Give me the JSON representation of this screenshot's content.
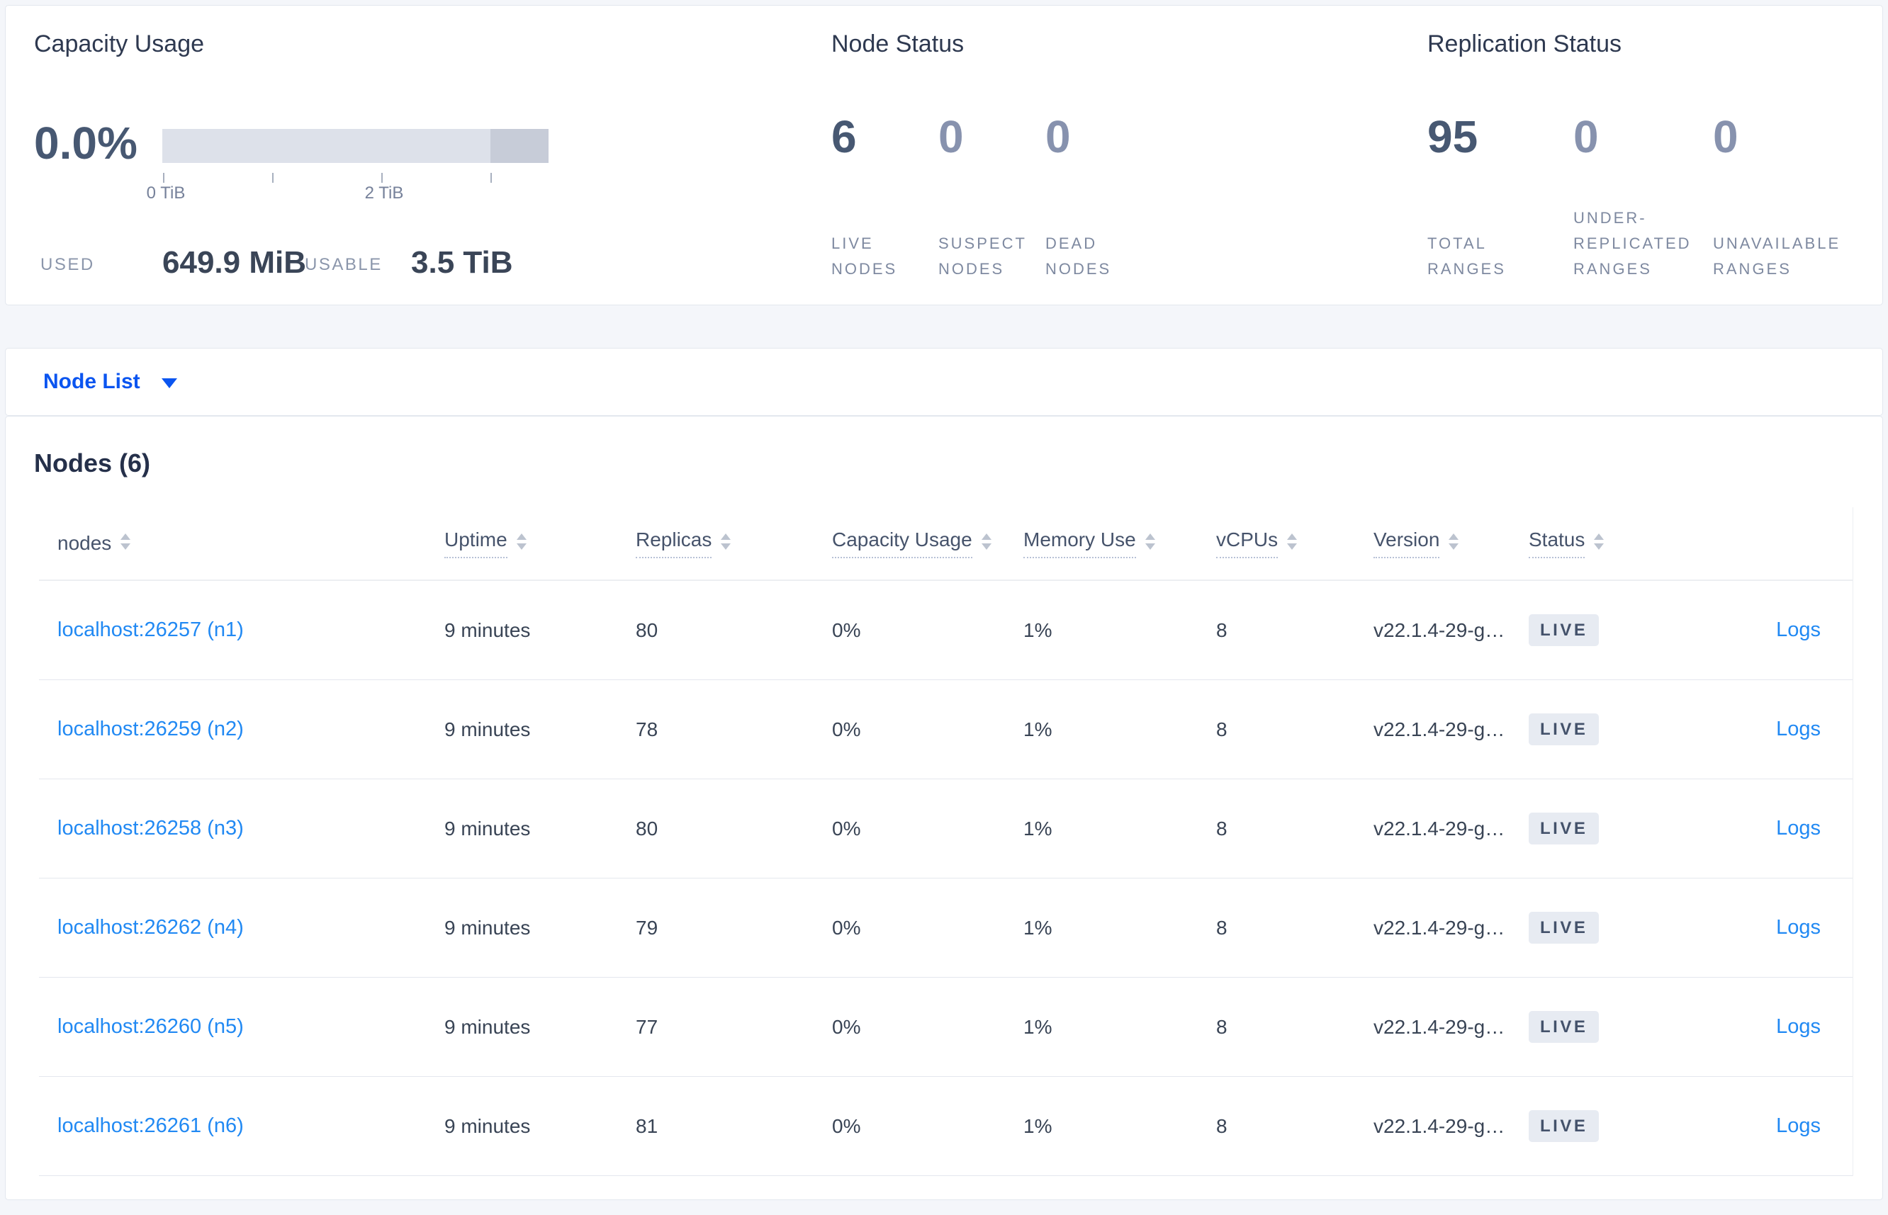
{
  "summary": {
    "capacity": {
      "title": "Capacity Usage",
      "percent": "0.0%",
      "axis_ticks": [
        "0 TiB",
        "2 TiB"
      ],
      "used_label": "USED",
      "used_value": "649.9 MiB",
      "usable_label": "USABLE",
      "usable_value": "3.5 TiB"
    },
    "node_status": {
      "title": "Node Status",
      "metrics": [
        {
          "value": "6",
          "label": "LIVE\nNODES",
          "emphasized": true
        },
        {
          "value": "0",
          "label": "SUSPECT\nNODES",
          "emphasized": false
        },
        {
          "value": "0",
          "label": "DEAD\nNODES",
          "emphasized": false
        }
      ]
    },
    "replication_status": {
      "title": "Replication Status",
      "metrics": [
        {
          "value": "95",
          "label": "TOTAL\nRANGES",
          "emphasized": true
        },
        {
          "value": "0",
          "label": "UNDER-\nREPLICATED\nRANGES",
          "emphasized": false
        },
        {
          "value": "0",
          "label": "UNAVAILABLE\nRANGES",
          "emphasized": false
        }
      ]
    }
  },
  "view_selector": {
    "label": "Node List"
  },
  "nodes_table": {
    "heading": "Nodes (6)",
    "logs_label": "Logs",
    "columns": [
      {
        "label": "nodes",
        "sortable": true,
        "tooltip_underline": false
      },
      {
        "label": "Uptime",
        "sortable": true,
        "tooltip_underline": true
      },
      {
        "label": "Replicas",
        "sortable": true,
        "tooltip_underline": true
      },
      {
        "label": "Capacity Usage",
        "sortable": true,
        "tooltip_underline": true
      },
      {
        "label": "Memory Use",
        "sortable": true,
        "tooltip_underline": true
      },
      {
        "label": "vCPUs",
        "sortable": true,
        "tooltip_underline": true
      },
      {
        "label": "Version",
        "sortable": true,
        "tooltip_underline": true
      },
      {
        "label": "Status",
        "sortable": true,
        "tooltip_underline": true
      }
    ],
    "rows": [
      {
        "address": "localhost:26257 (n1)",
        "uptime": "9 minutes",
        "replicas": "80",
        "capacity_usage": "0%",
        "memory_use": "1%",
        "vcpus": "8",
        "version": "v22.1.4-29-g…",
        "status": "LIVE"
      },
      {
        "address": "localhost:26259 (n2)",
        "uptime": "9 minutes",
        "replicas": "78",
        "capacity_usage": "0%",
        "memory_use": "1%",
        "vcpus": "8",
        "version": "v22.1.4-29-g…",
        "status": "LIVE"
      },
      {
        "address": "localhost:26258 (n3)",
        "uptime": "9 minutes",
        "replicas": "80",
        "capacity_usage": "0%",
        "memory_use": "1%",
        "vcpus": "8",
        "version": "v22.1.4-29-g…",
        "status": "LIVE"
      },
      {
        "address": "localhost:26262 (n4)",
        "uptime": "9 minutes",
        "replicas": "79",
        "capacity_usage": "0%",
        "memory_use": "1%",
        "vcpus": "8",
        "version": "v22.1.4-29-g…",
        "status": "LIVE"
      },
      {
        "address": "localhost:26260 (n5)",
        "uptime": "9 minutes",
        "replicas": "77",
        "capacity_usage": "0%",
        "memory_use": "1%",
        "vcpus": "8",
        "version": "v22.1.4-29-g…",
        "status": "LIVE"
      },
      {
        "address": "localhost:26261 (n6)",
        "uptime": "9 minutes",
        "replicas": "81",
        "capacity_usage": "0%",
        "memory_use": "1%",
        "vcpus": "8",
        "version": "v22.1.4-29-g…",
        "status": "LIVE"
      }
    ]
  },
  "colors": {
    "accent_blue": "#0b55f0",
    "link_blue": "#2189f3",
    "badge_bg": "#e7ebf2",
    "badge_text": "#44526b",
    "emphasized_number": "#475872",
    "muted_number": "#8792ae"
  }
}
